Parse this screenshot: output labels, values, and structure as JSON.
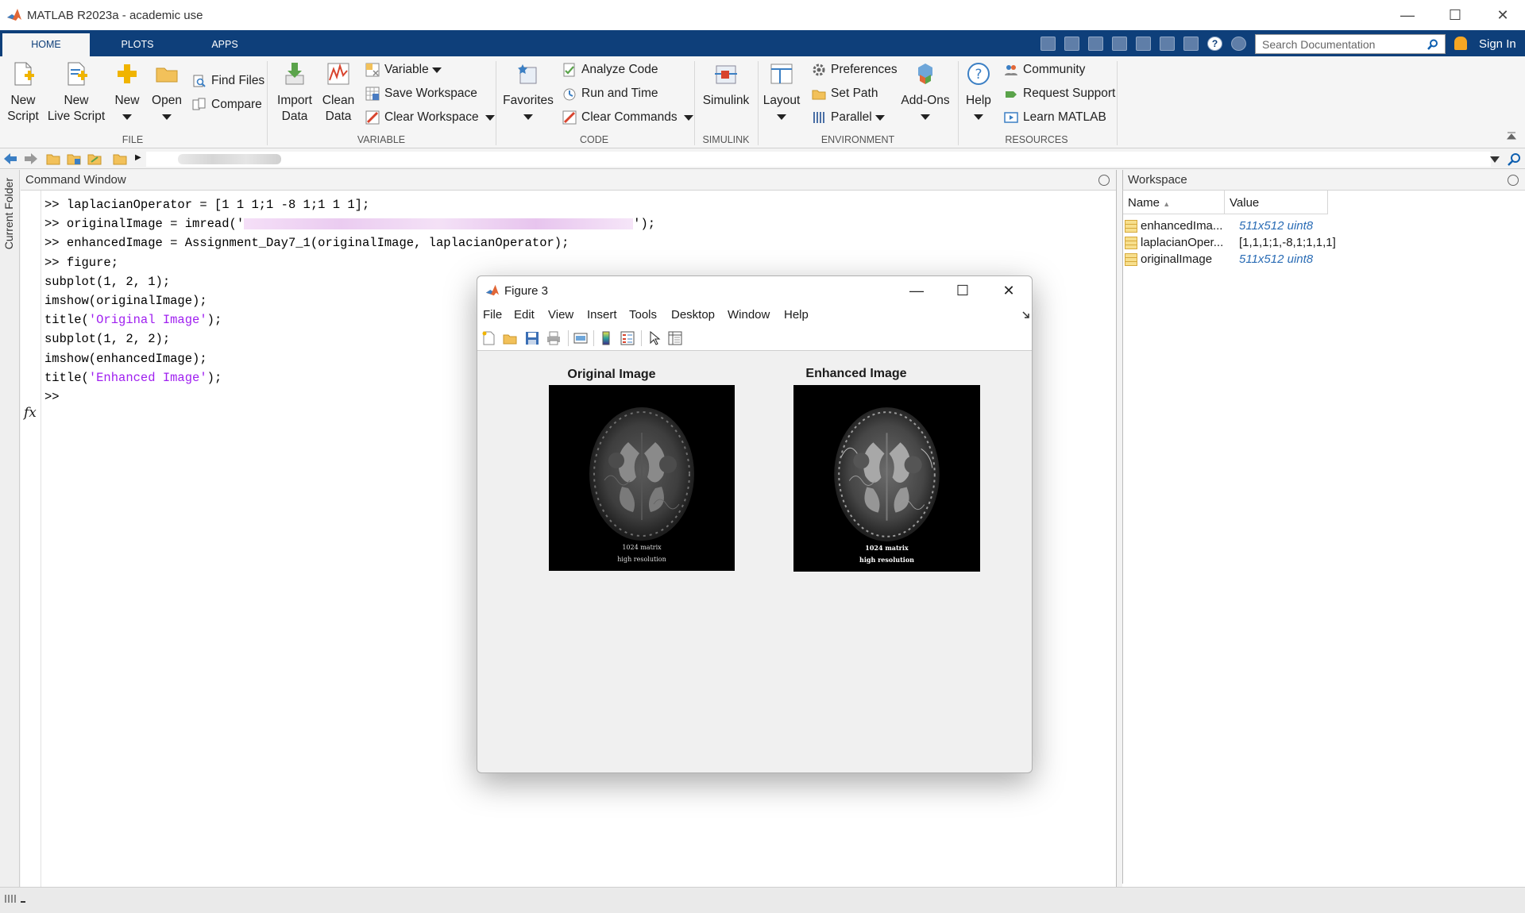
{
  "window": {
    "title": "MATLAB R2023a - academic use"
  },
  "tabs": [
    {
      "label": "HOME"
    },
    {
      "label": "PLOTS"
    },
    {
      "label": "APPS"
    }
  ],
  "search": {
    "placeholder": "Search Documentation"
  },
  "signin": "Sign In",
  "ribbon": {
    "file": {
      "new_script": [
        "New",
        "Script"
      ],
      "new_live_script": [
        "New",
        "Live Script"
      ],
      "new": "New",
      "open": "Open",
      "find_files": "Find Files",
      "compare": "Compare",
      "label": "FILE"
    },
    "variable": {
      "import": [
        "Import",
        "Data"
      ],
      "clean": [
        "Clean",
        "Data"
      ],
      "variable": "Variable",
      "save_workspace": "Save Workspace",
      "clear_workspace": "Clear Workspace",
      "label": "VARIABLE"
    },
    "code": {
      "favorites": "Favorites",
      "analyze": "Analyze Code",
      "run_time": "Run and Time",
      "clear_commands": "Clear Commands",
      "label": "CODE"
    },
    "simulink": {
      "simulink": "Simulink",
      "label": "SIMULINK"
    },
    "environment": {
      "layout": "Layout",
      "preferences": "Preferences",
      "set_path": "Set Path",
      "parallel": "Parallel",
      "addons": "Add-Ons",
      "label": "ENVIRONMENT"
    },
    "resources": {
      "help": "Help",
      "community": "Community",
      "request_support": "Request Support",
      "learn": "Learn MATLAB",
      "label": "RESOURCES"
    }
  },
  "sidebar": {
    "current_folder": "Current Folder"
  },
  "command_window": {
    "title": "Command Window",
    "lines": [
      {
        "prefix": ">> ",
        "text": "laplacianOperator = [1 1 1;1 -8 1;1 1 1];"
      },
      {
        "prefix": ">> ",
        "pre": "originalImage = imread('",
        "post": "');"
      },
      {
        "prefix": ">> ",
        "text": "enhancedImage = Assignment_Day7_1(originalImage, laplacianOperator);"
      },
      {
        "prefix": ">> ",
        "text": "figure;"
      },
      {
        "prefix": "",
        "text": "subplot(1, 2, 1);"
      },
      {
        "prefix": "",
        "text": "imshow(originalImage);"
      },
      {
        "prefix": "",
        "pre": "title(",
        "str": "'Original Image'",
        "post": ");"
      },
      {
        "prefix": "",
        "text": "subplot(1, 2, 2);"
      },
      {
        "prefix": "",
        "text": "imshow(enhancedImage);"
      },
      {
        "prefix": "",
        "pre": "title(",
        "str": "'Enhanced Image'",
        "post": ");"
      },
      {
        "prefix": "",
        "text": ">>"
      }
    ],
    "fx": "fx"
  },
  "workspace": {
    "title": "Workspace",
    "columns": [
      "Name",
      "Value"
    ],
    "rows": [
      {
        "name": "enhancedIma...",
        "value": "511x512 uint8",
        "italic": true
      },
      {
        "name": "laplacianOper...",
        "value": "[1,1,1;1,-8,1;1,1,1]",
        "italic": false
      },
      {
        "name": "originalImage",
        "value": "511x512 uint8",
        "italic": true
      }
    ]
  },
  "figure": {
    "title": "Figure 3",
    "menu": [
      "File",
      "Edit",
      "View",
      "Insert",
      "Tools",
      "Desktop",
      "Window",
      "Help"
    ],
    "axes": [
      {
        "title": "Original Image",
        "caption1": "1024 matrix",
        "caption2": "high resolution"
      },
      {
        "title": "Enhanced Image",
        "caption1": "1024 matrix",
        "caption2": "high resolution"
      }
    ]
  },
  "colors": {
    "accent": "#0e3f7a",
    "string": "#a020f0",
    "link": "#2a6cb5"
  }
}
